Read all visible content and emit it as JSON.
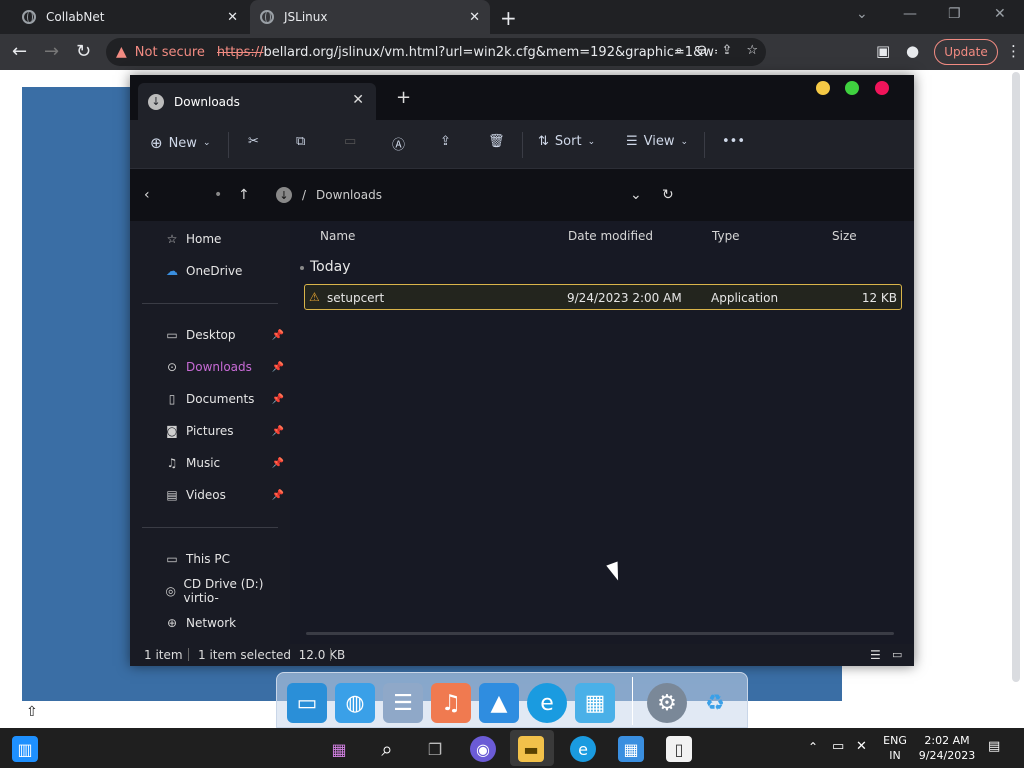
{
  "browser": {
    "tabs": [
      {
        "title": "CollabNet"
      },
      {
        "title": "JSLinux"
      }
    ],
    "security_label": "Not secure",
    "url_protocol": "https://",
    "url_rest": "bellard.org/jslinux/vm.html?url=win2k.cfg&mem=192&graphic=1&w=1...",
    "update_label": "Update"
  },
  "explorer": {
    "tab_title": "Downloads",
    "toolbar": {
      "new_label": "New",
      "sort_label": "Sort",
      "view_label": "View",
      "more_label": "•••"
    },
    "breadcrumb": {
      "separator": "/",
      "current": "Downloads"
    },
    "nav": {
      "home": "Home",
      "onedrive": "OneDrive",
      "desktop": "Desktop",
      "downloads": "Downloads",
      "documents": "Documents",
      "pictures": "Pictures",
      "music": "Music",
      "videos": "Videos",
      "this_pc": "This PC",
      "cd_drive": "CD Drive (D:) virtio-",
      "network": "Network"
    },
    "columns": {
      "name": "Name",
      "date": "Date modified",
      "type": "Type",
      "size": "Size"
    },
    "group": "Today",
    "files": [
      {
        "name": "setupcert",
        "date": "9/24/2023 2:00 AM",
        "type": "Application",
        "size": "12 KB"
      }
    ],
    "status": {
      "count": "1 item",
      "selection": "1 item selected  12.0 KB"
    }
  },
  "taskbar": {
    "lang_line1": "ENG",
    "lang_line2": "IN",
    "time": "2:02 AM",
    "date": "9/24/2023"
  },
  "colors": {
    "accent_downloads": "#c86bd6",
    "selection_border": "#d9b44a",
    "traffic_yellow": "#f5c945",
    "traffic_green": "#3fd13f",
    "traffic_red": "#f0145a"
  }
}
